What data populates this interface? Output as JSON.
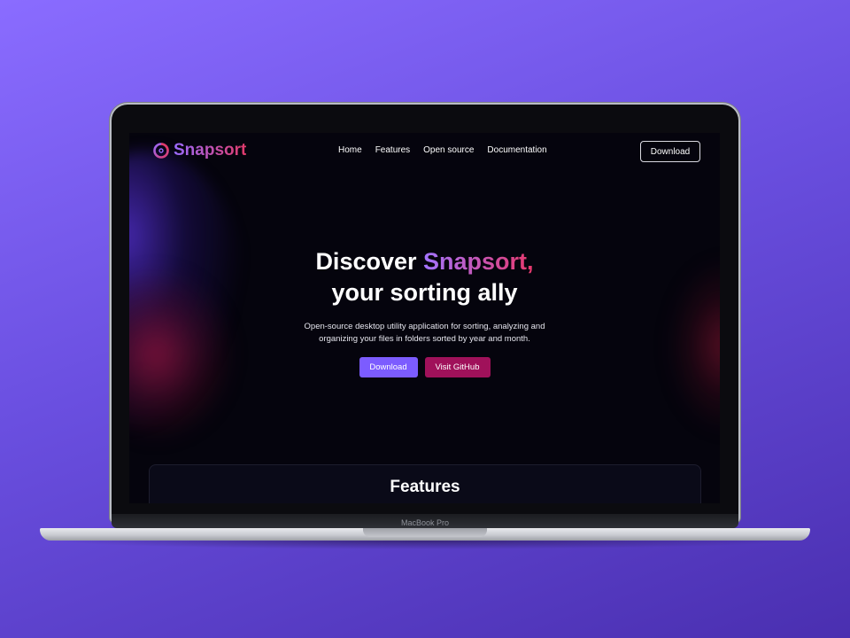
{
  "device": {
    "model_label": "MacBook Pro"
  },
  "nav": {
    "brand": "Snapsort",
    "links": [
      "Home",
      "Features",
      "Open source",
      "Documentation"
    ],
    "download_label": "Download"
  },
  "hero": {
    "title_prefix": "Discover ",
    "title_accent": "Snapsort,",
    "title_suffix": " your sorting ally",
    "subtitle": "Open-source desktop utility application for sorting, analyzing and organizing your files in folders sorted by year and month.",
    "download_label": "Download",
    "github_label": "Visit GitHub"
  },
  "features": {
    "title": "Features"
  },
  "colors": {
    "background_start": "#8a6cff",
    "background_end": "#4a2fb0",
    "screen_bg": "#05040d",
    "accent_purple": "#7c5cff",
    "accent_magenta": "#a0115a",
    "brand_gradient_end": "#e03a6a"
  },
  "icons": {
    "brand_logo": "snapsort-logo-icon"
  }
}
